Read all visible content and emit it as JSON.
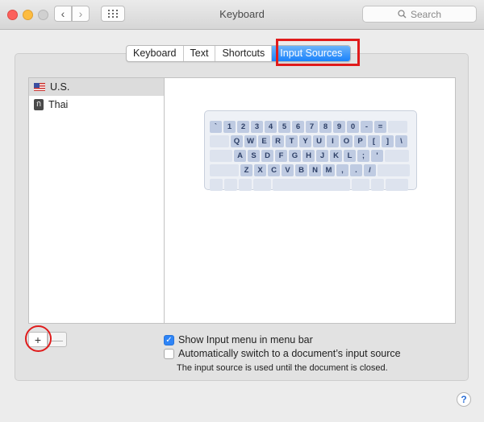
{
  "window": {
    "title": "Keyboard",
    "search_placeholder": "Search"
  },
  "toolbar": {
    "back_icon": "‹",
    "forward_icon": "›"
  },
  "tabs": [
    {
      "label": "Keyboard",
      "active": false
    },
    {
      "label": "Text",
      "active": false
    },
    {
      "label": "Shortcuts",
      "active": false
    },
    {
      "label": "Input Sources",
      "active": true
    }
  ],
  "input_sources": [
    {
      "label": "U.S.",
      "icon": "us-flag-icon",
      "selected": true
    },
    {
      "label": "Thai",
      "icon": "thai-input-icon",
      "selected": false
    }
  ],
  "keyboard_preview": {
    "row1": [
      "`",
      "1",
      "2",
      "3",
      "4",
      "5",
      "6",
      "7",
      "8",
      "9",
      "0",
      "-",
      "="
    ],
    "row2": [
      "Q",
      "W",
      "E",
      "R",
      "T",
      "Y",
      "U",
      "I",
      "O",
      "P",
      "[",
      "]",
      "\\"
    ],
    "row3": [
      "A",
      "S",
      "D",
      "F",
      "G",
      "H",
      "J",
      "K",
      "L",
      ";",
      "'"
    ],
    "row4": [
      "Z",
      "X",
      "C",
      "V",
      "B",
      "N",
      "M",
      ",",
      ".",
      "/"
    ]
  },
  "list_controls": {
    "add_label": "+",
    "remove_label": "—"
  },
  "options": {
    "show_menu_label": "Show Input menu in menu bar",
    "show_menu_checked": true,
    "auto_switch_label": "Automatically switch to a document’s input source",
    "auto_switch_checked": false,
    "note": "The input source is used until the document is closed."
  },
  "help_label": "?",
  "colors": {
    "active_tab": "#1a82fb",
    "highlight": "#e01b1b",
    "checkbox_on": "#2e84f6"
  }
}
